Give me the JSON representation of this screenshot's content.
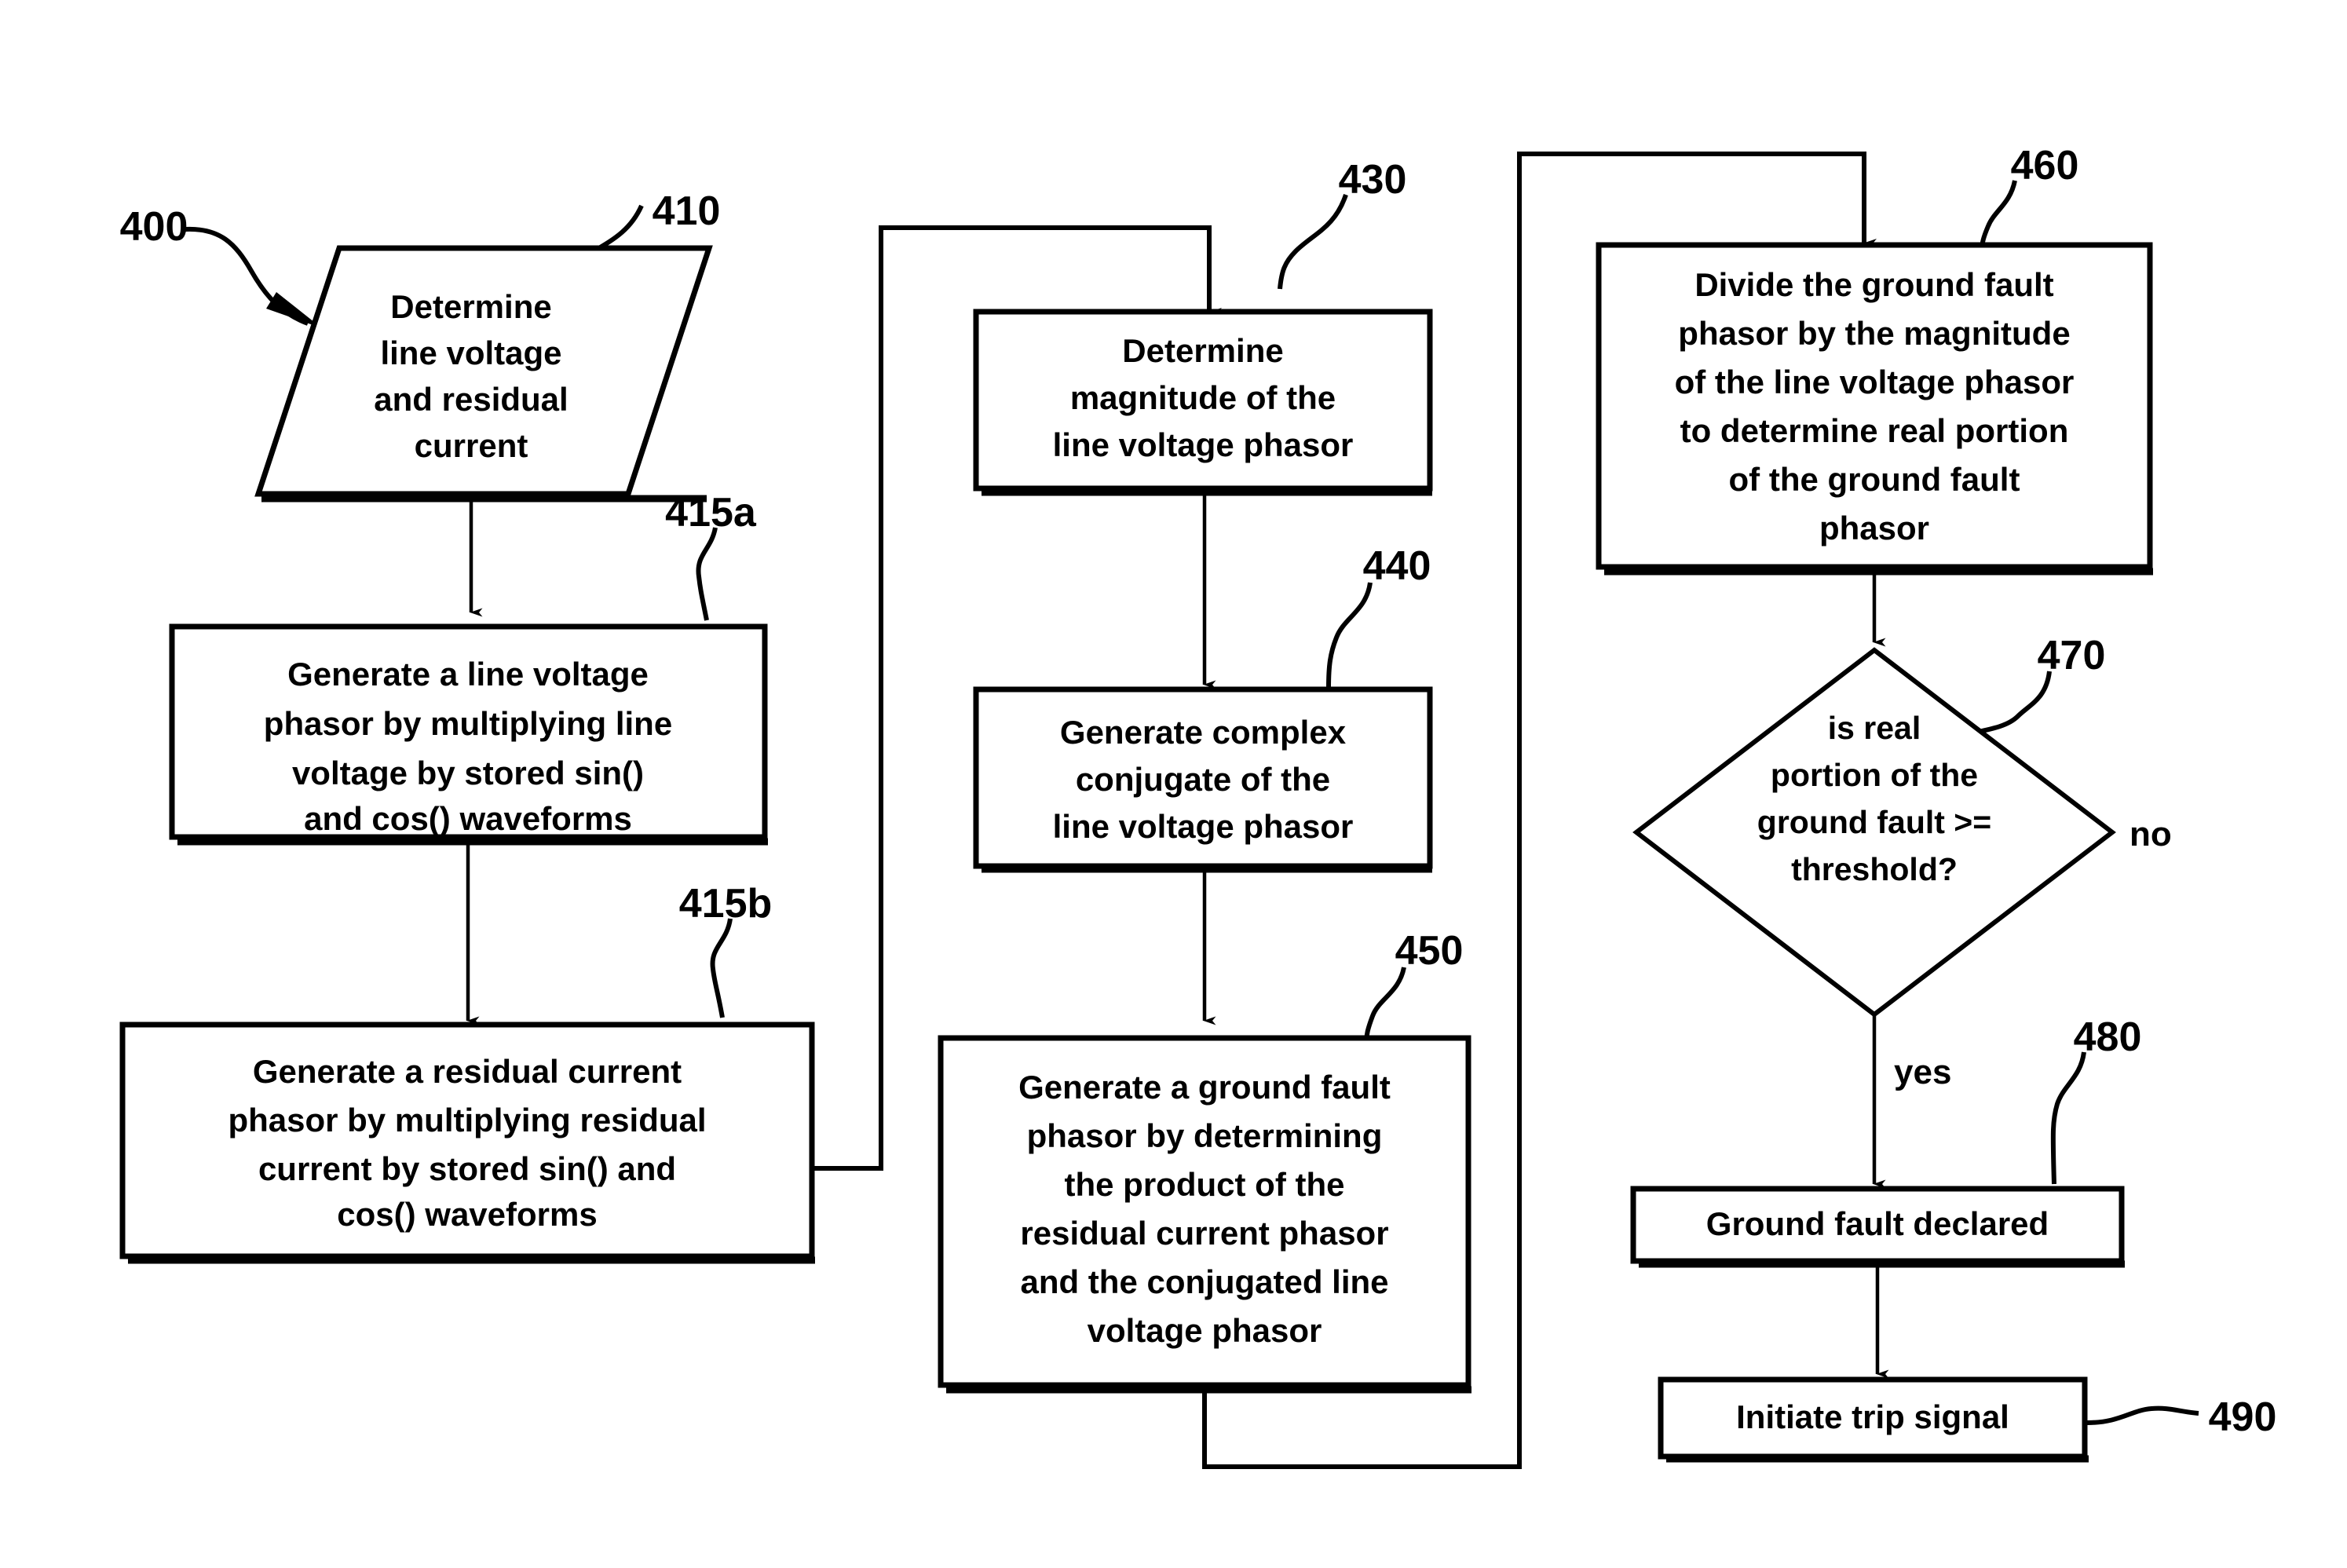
{
  "figure": {
    "type": "flowchart",
    "title": "Ground fault detection flowchart",
    "nodes": [
      {
        "ref": "400",
        "kind": "reference-pointer",
        "label": "400",
        "points_to": "410"
      },
      {
        "ref": "410",
        "kind": "input-output",
        "lines": [
          "Determine",
          "line voltage",
          "and residual",
          "current"
        ]
      },
      {
        "ref": "415a",
        "kind": "process",
        "lines": [
          "Generate a line voltage",
          "phasor by multiplying line",
          "voltage by stored sin()",
          "and cos() waveforms"
        ]
      },
      {
        "ref": "415b",
        "kind": "process",
        "lines": [
          "Generate a residual current",
          "phasor by multiplying residual",
          "current by stored sin() and",
          "cos() waveforms"
        ]
      },
      {
        "ref": "430",
        "kind": "process",
        "lines": [
          "Determine",
          "magnitude of the",
          "line voltage phasor"
        ]
      },
      {
        "ref": "440",
        "kind": "process",
        "lines": [
          "Generate complex",
          "conjugate of the",
          "line voltage phasor"
        ]
      },
      {
        "ref": "450",
        "kind": "process",
        "lines": [
          "Generate a ground fault",
          "phasor by determining",
          "the product of the",
          "residual current phasor",
          "and the conjugated line",
          "voltage phasor"
        ]
      },
      {
        "ref": "460",
        "kind": "process",
        "lines": [
          "Divide the ground fault",
          "phasor by the magnitude",
          "of the line voltage phasor",
          "to determine real portion",
          "of the ground fault",
          "phasor"
        ]
      },
      {
        "ref": "470",
        "kind": "decision",
        "lines": [
          "is real",
          "portion of the",
          "ground fault >=",
          "threshold?"
        ]
      },
      {
        "ref": "480",
        "kind": "process",
        "lines": [
          "Ground fault declared"
        ]
      },
      {
        "ref": "490",
        "kind": "process",
        "lines": [
          "Initiate trip signal"
        ]
      }
    ],
    "branch_labels": {
      "no": "no",
      "yes": "yes"
    },
    "reference_numerals": {
      "n400": "400",
      "n410": "410",
      "n415a": "415a",
      "n415b": "415b",
      "n430": "430",
      "n440": "440",
      "n450": "450",
      "n460": "460",
      "n470": "470",
      "n480": "480",
      "n490": "490"
    },
    "node_text": {
      "n410": {
        "l1": "Determine",
        "l2": "line voltage",
        "l3": "and residual",
        "l4": "current"
      },
      "n415a": {
        "l1": "Generate a line voltage",
        "l2": "phasor by multiplying line",
        "l3": "voltage by stored sin()",
        "l4": "and cos() waveforms"
      },
      "n415b": {
        "l1": "Generate a residual current",
        "l2": "phasor by multiplying residual",
        "l3": "current by stored sin() and",
        "l4": "cos() waveforms"
      },
      "n430": {
        "l1": "Determine",
        "l2": "magnitude of the",
        "l3": "line voltage phasor"
      },
      "n440": {
        "l1": "Generate complex",
        "l2": "conjugate of the",
        "l3": "line voltage phasor"
      },
      "n450": {
        "l1": "Generate a ground fault",
        "l2": "phasor by determining",
        "l3": "the product of the",
        "l4": "residual current phasor",
        "l5": "and the conjugated line",
        "l6": "voltage phasor"
      },
      "n460": {
        "l1": "Divide the ground fault",
        "l2": "phasor by the magnitude",
        "l3": "of the line voltage phasor",
        "l4": "to determine real portion",
        "l5": "of the ground fault",
        "l6": "phasor"
      },
      "n470": {
        "l1": "is real",
        "l2": "portion of the",
        "l3": "ground fault >=",
        "l4": "threshold?"
      },
      "n480": {
        "l1": "Ground fault declared"
      },
      "n490": {
        "l1": "Initiate trip signal"
      }
    },
    "colors": {
      "stroke": "#000000",
      "fill": "#ffffff",
      "text": "#000000"
    }
  }
}
